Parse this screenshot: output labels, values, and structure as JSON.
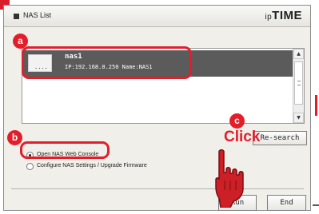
{
  "window": {
    "title": "NAS List",
    "brand_prefix": "ip",
    "brand_name": "TIME"
  },
  "nas_list": {
    "items": [
      {
        "name": "nas1",
        "info": "IP:192.168.0.250  Name:NAS1",
        "thumb_text": "....",
        "selected": true
      }
    ]
  },
  "buttons": {
    "research": "Re-search",
    "run": "Run",
    "end": "End"
  },
  "options": {
    "web_console": "Open NAS Web Console",
    "upgrade": "Configure NAS Settings / Upgrade Firmware",
    "selected": "web_console"
  },
  "annotations": {
    "a": "a",
    "b": "b",
    "c": "c",
    "click": "Click",
    "accent_color": "#e31e2b"
  }
}
